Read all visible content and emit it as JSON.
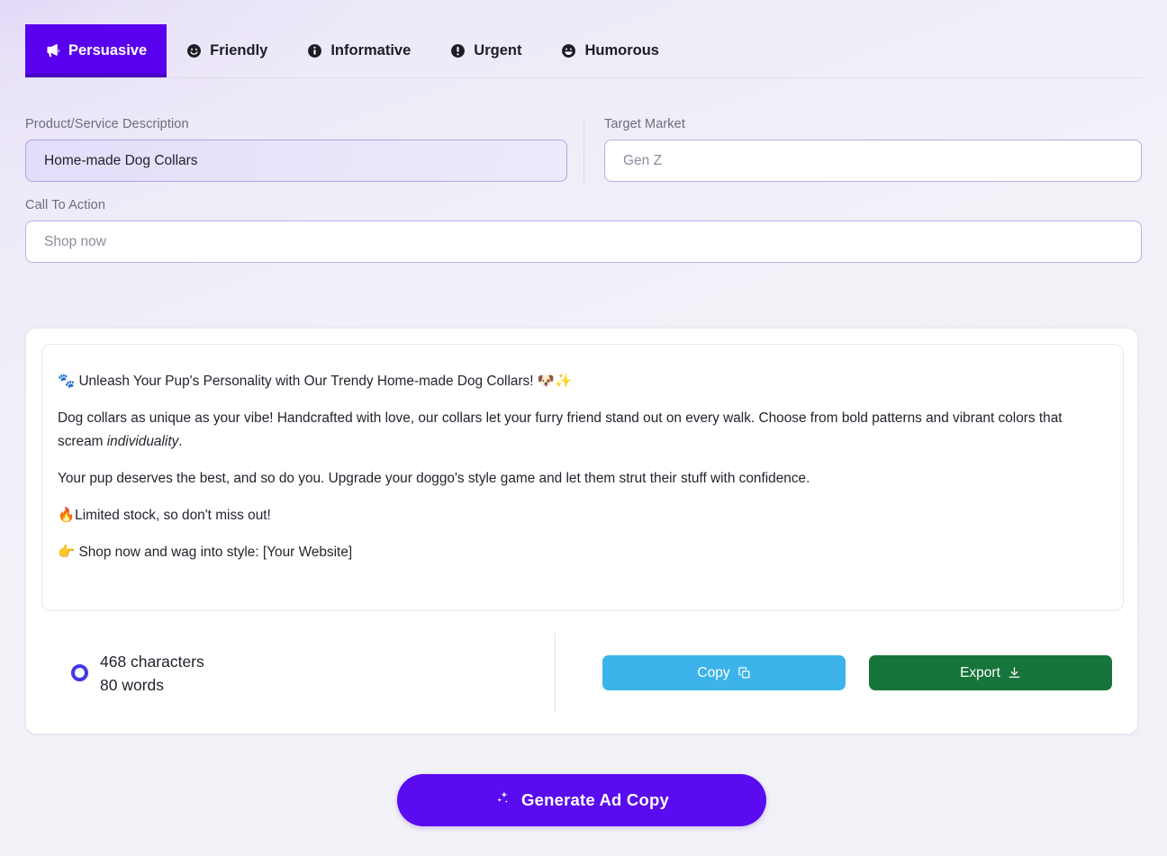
{
  "tabs": [
    {
      "label": "Persuasive",
      "icon": "megaphone-icon",
      "active": true
    },
    {
      "label": "Friendly",
      "icon": "smiley-face-icon",
      "active": false
    },
    {
      "label": "Informative",
      "icon": "info-circle-icon",
      "active": false
    },
    {
      "label": "Urgent",
      "icon": "exclamation-circle-icon",
      "active": false
    },
    {
      "label": "Humorous",
      "icon": "grinning-face-icon",
      "active": false
    }
  ],
  "form": {
    "product": {
      "label": "Product/Service Description",
      "value": "Home-made Dog Collars",
      "placeholder": "Home-made Dog Collars"
    },
    "target_market": {
      "label": "Target Market",
      "value": "",
      "placeholder": "Gen Z"
    },
    "call_to_action": {
      "label": "Call To Action",
      "value": "",
      "placeholder": "Shop now"
    }
  },
  "result": {
    "paragraphs": {
      "headline": "🐾 Unleash Your Pup's Personality with Our Trendy Home-made Dog Collars! 🐶✨",
      "body_a_pre": "Dog collars as unique as your vibe! Handcrafted with love, our collars let your furry friend stand out on every walk. Choose from bold patterns and vibrant colors that scream ",
      "body_a_em": "individuality",
      "body_a_post": ".",
      "body_b": "Your pup deserves the best, and so do you. Upgrade your doggo's style game and let them strut their stuff with confidence.",
      "body_c": "🔥Limited stock, so don't miss out!",
      "body_d": "👉 Shop now and wag into style: [Your Website]"
    },
    "stats": {
      "characters": "468 characters",
      "words": "80 words"
    },
    "actions": {
      "copy_label": "Copy",
      "export_label": "Export"
    }
  },
  "generate": {
    "label": "Generate Ad Copy",
    "icon": "sparkles-icon"
  },
  "colors": {
    "accent_purple": "#5800ee",
    "generate_purple": "#5a0bef",
    "copy_blue": "#3cb4eb",
    "export_green": "#17743a",
    "ring_indigo": "#4338e8",
    "field_border": "#b9aee8"
  }
}
